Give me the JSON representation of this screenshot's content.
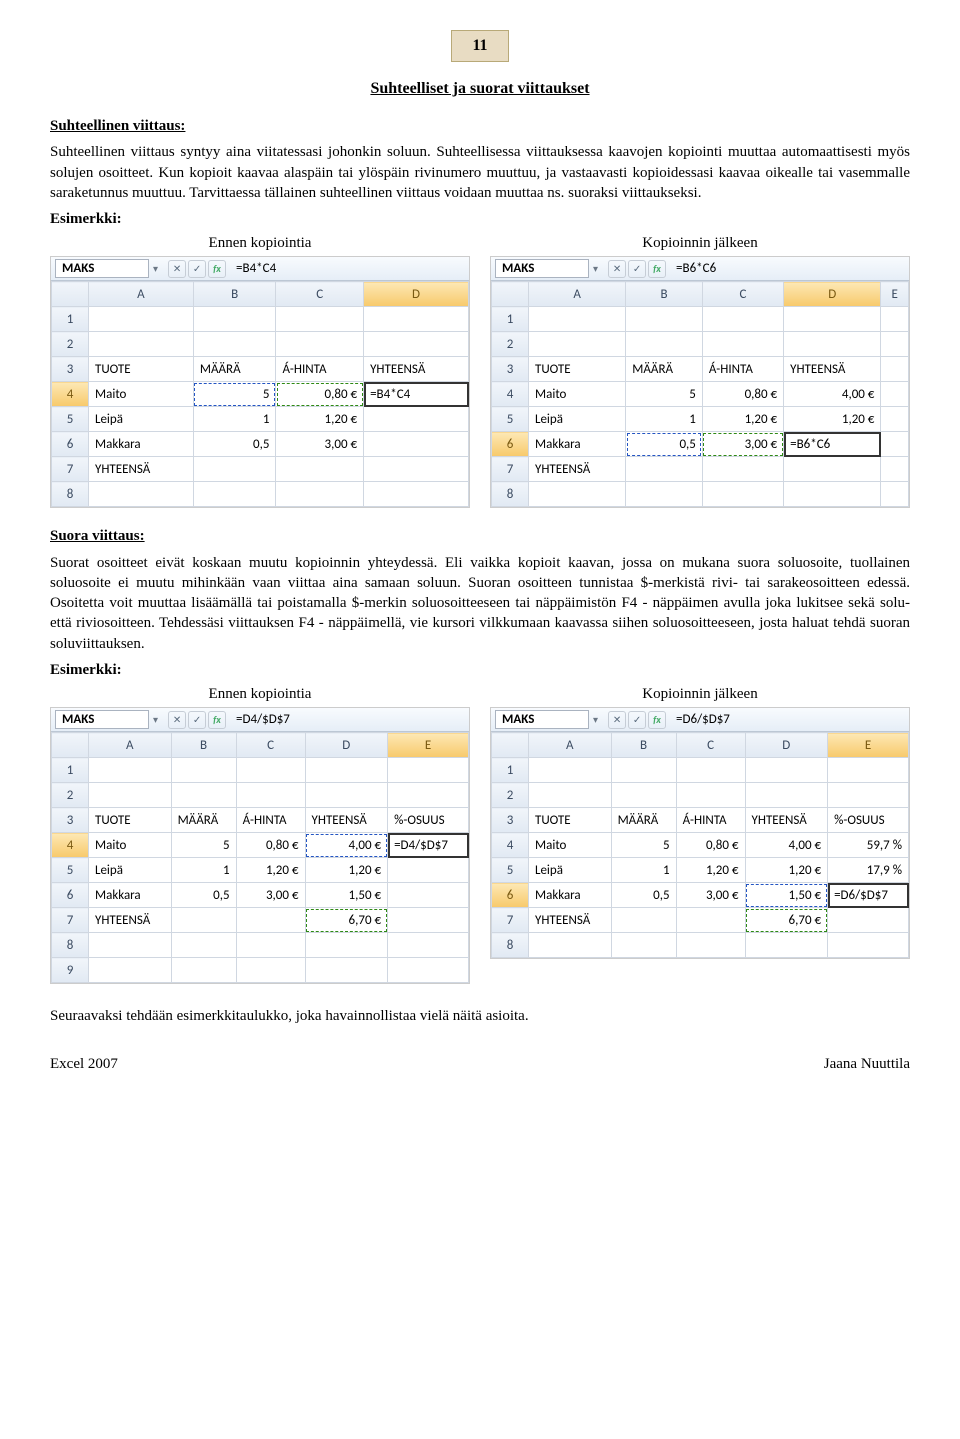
{
  "pageNumber": "11",
  "title": "Suhteelliset ja suorat viittaukset",
  "sect1": {
    "heading": "Suhteellinen viittaus:",
    "body": "Suhteellinen viittaus syntyy aina viitatessasi johonkin soluun. Suhteellisessa viittauksessa kaavojen kopiointi muuttaa automaattisesti myös solujen osoitteet. Kun kopioit kaavaa alaspäin tai ylöspäin rivinumero muuttuu, ja vastaavasti kopioidessasi kaavaa oikealle tai vasemmalle saraketunnus muuttuu. Tarvittaessa tällainen suhteellinen viittaus voidaan muuttaa ns. suoraksi viittaukseksi.",
    "exLabel": "Esimerkki:",
    "capBefore": "Ennen kopiointia",
    "capAfter": "Kopioinnin jälkeen"
  },
  "xl1a": {
    "nameBox": "MAKS",
    "formula": "=B4*C4",
    "cols": [
      "A",
      "B",
      "C",
      "D"
    ],
    "rows": [
      {
        "n": "1",
        "c": [
          "",
          "",
          "",
          ""
        ]
      },
      {
        "n": "2",
        "c": [
          "",
          "",
          "",
          ""
        ]
      },
      {
        "n": "3",
        "c": [
          "TUOTE",
          "MÄÄRÄ",
          "Á-HINTA",
          "YHTEENSÄ"
        ]
      },
      {
        "n": "4",
        "c": [
          "Maito",
          "5",
          "0,80 €",
          "=B4*C4"
        ],
        "sel": 3,
        "activeRow": true,
        "dashB": 1,
        "dashG": 2
      },
      {
        "n": "5",
        "c": [
          "Leipä",
          "1",
          "1,20 €",
          ""
        ]
      },
      {
        "n": "6",
        "c": [
          "Makkara",
          "0,5",
          "3,00 €",
          ""
        ]
      },
      {
        "n": "7",
        "c": [
          "YHTEENSÄ",
          "",
          "",
          ""
        ]
      },
      {
        "n": "8",
        "c": [
          "",
          "",
          "",
          ""
        ]
      }
    ],
    "activeCol": 3
  },
  "xl1b": {
    "nameBox": "MAKS",
    "formula": "=B6*C6",
    "cols": [
      "A",
      "B",
      "C",
      "D",
      "E"
    ],
    "rows": [
      {
        "n": "1",
        "c": [
          "",
          "",
          "",
          "",
          ""
        ]
      },
      {
        "n": "2",
        "c": [
          "",
          "",
          "",
          "",
          ""
        ]
      },
      {
        "n": "3",
        "c": [
          "TUOTE",
          "MÄÄRÄ",
          "Á-HINTA",
          "YHTEENSÄ",
          ""
        ]
      },
      {
        "n": "4",
        "c": [
          "Maito",
          "5",
          "0,80 €",
          "4,00 €",
          ""
        ]
      },
      {
        "n": "5",
        "c": [
          "Leipä",
          "1",
          "1,20 €",
          "1,20 €",
          ""
        ]
      },
      {
        "n": "6",
        "c": [
          "Makkara",
          "0,5",
          "3,00 €",
          "=B6*C6",
          ""
        ],
        "sel": 3,
        "activeRow": true,
        "dashB": 1,
        "dashG": 2
      },
      {
        "n": "7",
        "c": [
          "YHTEENSÄ",
          "",
          "",
          "",
          ""
        ]
      },
      {
        "n": "8",
        "c": [
          "",
          "",
          "",
          "",
          ""
        ]
      }
    ],
    "activeCol": 3
  },
  "sect2": {
    "heading": "Suora viittaus:",
    "body": "Suorat osoitteet eivät koskaan muutu kopioinnin yhteydessä. Eli vaikka kopioit kaavan, jossa on mukana suora soluosoite, tuollainen soluosoite ei muutu mihinkään vaan viittaa aina samaan soluun. Suoran osoitteen tunnistaa $-merkistä rivi- tai sarakeosoitteen edessä. Osoitetta voit muuttaa lisäämällä tai poistamalla $-merkin soluosoitteeseen tai näppäimistön F4 - näppäimen avulla joka lukitsee sekä solu- että riviosoitteen. Tehdessäsi viittauksen F4 - näppäimellä, vie kursori vilkkumaan kaavassa siihen soluosoitteeseen, josta haluat tehdä suoran soluviittauksen.",
    "exLabel": "Esimerkki:",
    "capBefore": "Ennen kopiointia",
    "capAfter": "Kopioinnin jälkeen"
  },
  "xl2a": {
    "nameBox": "MAKS",
    "formula": "=D4/$D$7",
    "cols": [
      "A",
      "B",
      "C",
      "D",
      "E"
    ],
    "rows": [
      {
        "n": "1",
        "c": [
          "",
          "",
          "",
          "",
          ""
        ]
      },
      {
        "n": "2",
        "c": [
          "",
          "",
          "",
          "",
          ""
        ]
      },
      {
        "n": "3",
        "c": [
          "TUOTE",
          "MÄÄRÄ",
          "Á-HINTA",
          "YHTEENSÄ",
          "%-OSUUS"
        ]
      },
      {
        "n": "4",
        "c": [
          "Maito",
          "5",
          "0,80 €",
          "4,00 €",
          "=D4/$D$7"
        ],
        "sel": 4,
        "activeRow": true,
        "dashB": 3
      },
      {
        "n": "5",
        "c": [
          "Leipä",
          "1",
          "1,20 €",
          "1,20 €",
          ""
        ]
      },
      {
        "n": "6",
        "c": [
          "Makkara",
          "0,5",
          "3,00 €",
          "1,50 €",
          ""
        ]
      },
      {
        "n": "7",
        "c": [
          "YHTEENSÄ",
          "",
          "",
          "6,70 €",
          ""
        ],
        "dashG": 3
      },
      {
        "n": "8",
        "c": [
          "",
          "",
          "",
          "",
          ""
        ]
      },
      {
        "n": "9",
        "c": [
          "",
          "",
          "",
          "",
          ""
        ]
      }
    ],
    "activeCol": 4
  },
  "xl2b": {
    "nameBox": "MAKS",
    "formula": "=D6/$D$7",
    "cols": [
      "A",
      "B",
      "C",
      "D",
      "E"
    ],
    "rows": [
      {
        "n": "1",
        "c": [
          "",
          "",
          "",
          "",
          ""
        ]
      },
      {
        "n": "2",
        "c": [
          "",
          "",
          "",
          "",
          ""
        ]
      },
      {
        "n": "3",
        "c": [
          "TUOTE",
          "MÄÄRÄ",
          "Á-HINTA",
          "YHTEENSÄ",
          "%-OSUUS"
        ]
      },
      {
        "n": "4",
        "c": [
          "Maito",
          "5",
          "0,80 €",
          "4,00 €",
          "59,7 %"
        ]
      },
      {
        "n": "5",
        "c": [
          "Leipä",
          "1",
          "1,20 €",
          "1,20 €",
          "17,9 %"
        ]
      },
      {
        "n": "6",
        "c": [
          "Makkara",
          "0,5",
          "3,00 €",
          "1,50 €",
          "=D6/$D$7"
        ],
        "sel": 4,
        "activeRow": true,
        "dashB": 3
      },
      {
        "n": "7",
        "c": [
          "YHTEENSÄ",
          "",
          "",
          "6,70 €",
          ""
        ],
        "dashG": 3
      },
      {
        "n": "8",
        "c": [
          "",
          "",
          "",
          "",
          ""
        ]
      }
    ],
    "activeCol": 4
  },
  "closing": "Seuraavaksi tehdään esimerkkitaulukko, joka havainnollistaa vielä näitä asioita.",
  "footerLeft": "Excel 2007",
  "footerRight": "Jaana Nuuttila",
  "fxIcons": {
    "cancel": "✕",
    "accept": "✓",
    "fx": "fx"
  }
}
